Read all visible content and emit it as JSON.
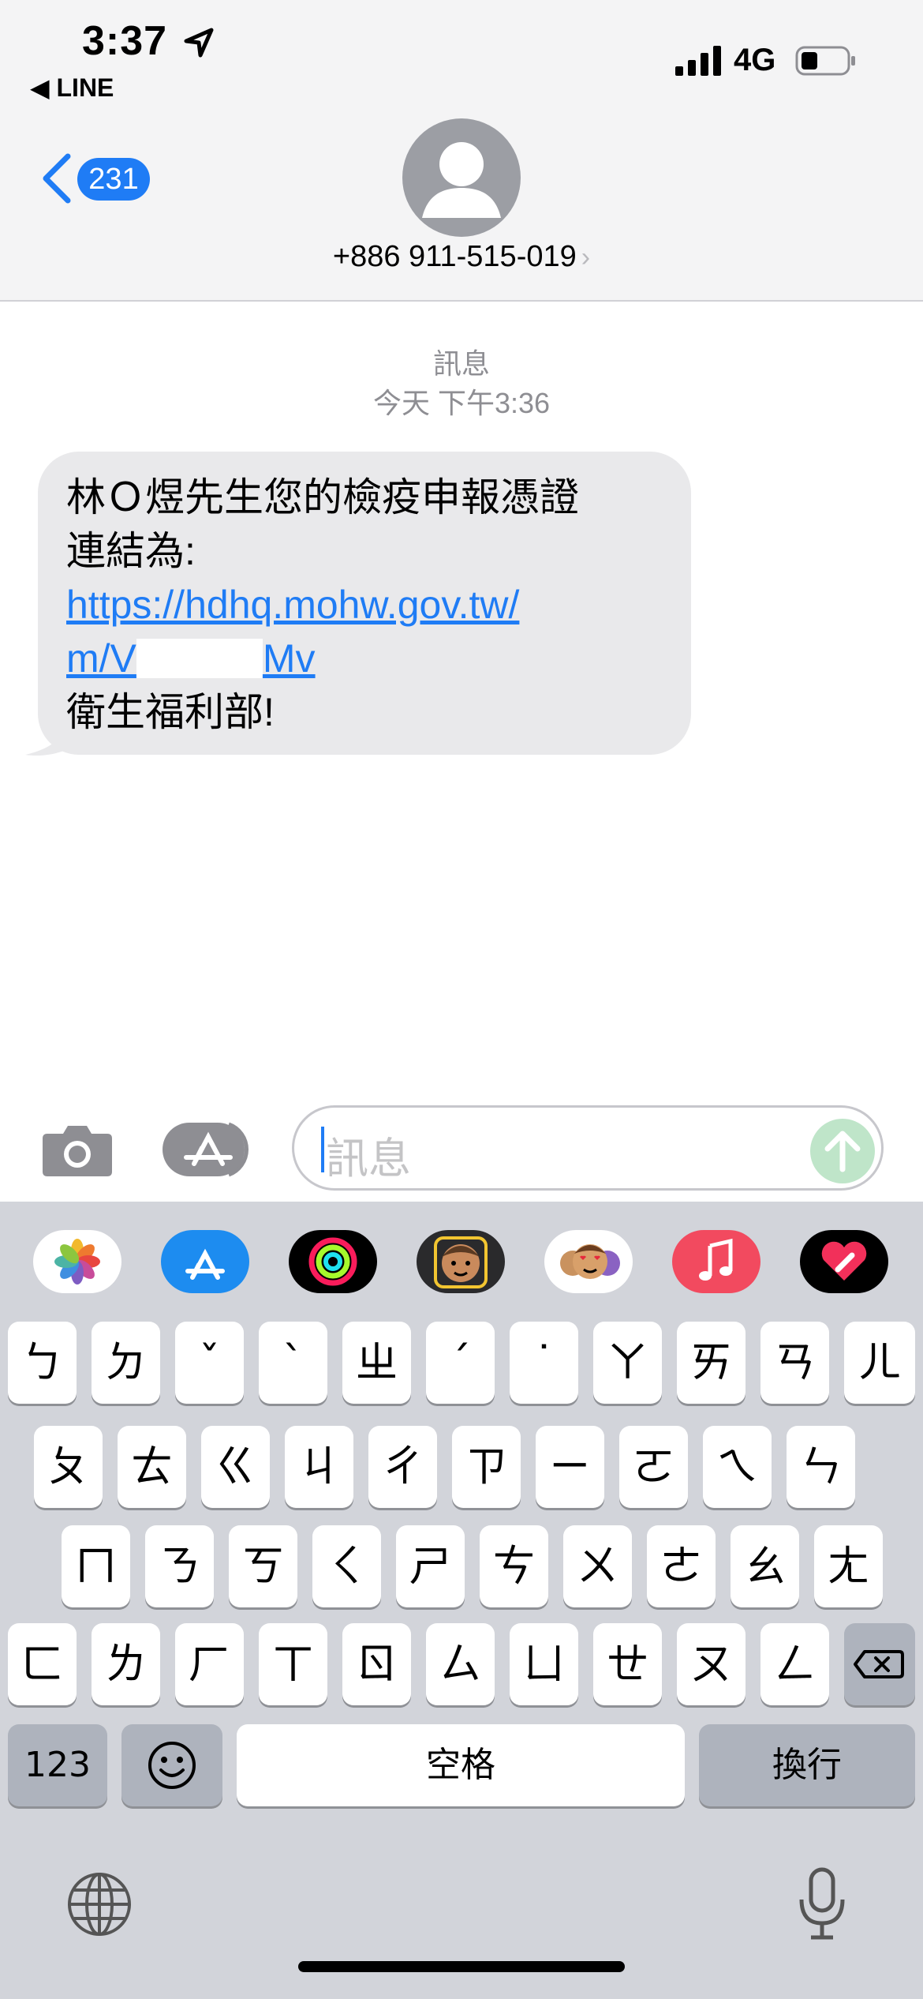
{
  "status_bar": {
    "time": "3:37",
    "back_app": "◀ LINE",
    "network": "4G",
    "icons": [
      "location-arrow-icon",
      "signal-icon",
      "battery-icon"
    ]
  },
  "header": {
    "back_count": "231",
    "contact": "+886 911-515-019",
    "contact_chevron": "›"
  },
  "conversation": {
    "service": "訊息",
    "timestamp": "今天 下午3:36",
    "message": {
      "line1": "林Ｏ煜先生您的檢疫申報憑證",
      "line2": "連結為:",
      "link_line1": "https://hdhq.mohw.gov.tw/",
      "link_line2_start": "m/V",
      "link_line2_end": "Mv",
      "line_last": "衛生福利部!"
    }
  },
  "composer": {
    "placeholder": "訊息"
  },
  "keyboard": {
    "app_strip": [
      "photos-icon",
      "app-store-icon",
      "activity-icon",
      "memoji-icon",
      "animoji-stickers-icon",
      "music-icon",
      "digital-touch-icon"
    ],
    "row1": [
      "ㄅ",
      "ㄉ",
      "ˇ",
      "ˋ",
      "ㄓ",
      "ˊ",
      "˙",
      "ㄚ",
      "ㄞ",
      "ㄢ",
      "ㄦ"
    ],
    "row2": [
      "ㄆ",
      "ㄊ",
      "ㄍ",
      "ㄐ",
      "ㄔ",
      "ㄗ",
      "ㄧ",
      "ㄛ",
      "ㄟ",
      "ㄣ"
    ],
    "row3": [
      "ㄇ",
      "ㄋ",
      "ㄎ",
      "ㄑ",
      "ㄕ",
      "ㄘ",
      "ㄨ",
      "ㄜ",
      "ㄠ",
      "ㄤ"
    ],
    "row4": [
      "ㄈ",
      "ㄌ",
      "ㄏ",
      "ㄒ",
      "ㄖ",
      "ㄙ",
      "ㄩ",
      "ㄝ",
      "ㄡ",
      "ㄥ"
    ],
    "numbers_key": "123",
    "space_key": "空格",
    "return_key": "換行",
    "icons": [
      "emoji-icon",
      "globe-icon",
      "microphone-icon",
      "delete-icon"
    ]
  },
  "colors": {
    "accent": "#1f7cf5",
    "bubble_gray": "#e9e9eb",
    "keyboard_bg": "#d2d4da",
    "send_disabled": "#bfe5c9"
  }
}
